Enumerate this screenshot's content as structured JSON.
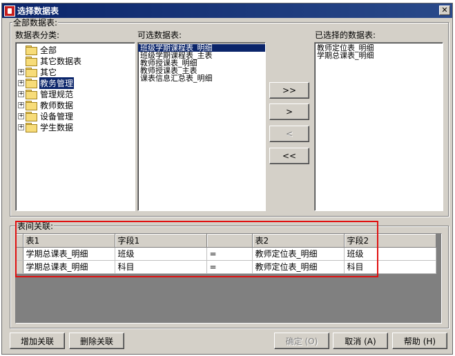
{
  "window": {
    "title": "选择数据表",
    "close_glyph": "✕"
  },
  "all_tables": {
    "group_title": "全部数据表:",
    "category_label": "数据表分类:",
    "available_label": "可选数据表:",
    "selected_label": "已选择的数据表:"
  },
  "categories": [
    {
      "label": "全部",
      "expandable": false,
      "selected": false
    },
    {
      "label": "其它数据表",
      "expandable": false,
      "selected": false
    },
    {
      "label": "其它",
      "expandable": true,
      "selected": false
    },
    {
      "label": "教务管理",
      "expandable": true,
      "selected": true
    },
    {
      "label": "管理规范",
      "expandable": true,
      "selected": false
    },
    {
      "label": "教师数据",
      "expandable": true,
      "selected": false
    },
    {
      "label": "设备管理",
      "expandable": true,
      "selected": false
    },
    {
      "label": "学生数据",
      "expandable": true,
      "selected": false
    }
  ],
  "available_tables": [
    {
      "label": "班级学期课程表_明细",
      "selected": true
    },
    {
      "label": "班级学期课程表_主表",
      "selected": false
    },
    {
      "label": "教师授课表_明细",
      "selected": false
    },
    {
      "label": "教师授课表_主表",
      "selected": false
    },
    {
      "label": "课表信息汇总表_明细",
      "selected": false
    }
  ],
  "selected_tables": [
    {
      "label": "教师定位表_明细"
    },
    {
      "label": "学期总课表_明细"
    }
  ],
  "transfer_buttons": {
    "add_all": ">>",
    "add_one": ">",
    "remove_one": "<",
    "remove_all": "<<"
  },
  "relations": {
    "group_title": "表间关联:",
    "columns": [
      "表1",
      "字段1",
      "",
      "表2",
      "字段2"
    ],
    "rows": [
      [
        "学期总课表_明细",
        "班级",
        "=",
        "教师定位表_明细",
        "班级"
      ],
      [
        "学期总课表_明细",
        "科目",
        "=",
        "教师定位表_明细",
        "科目"
      ]
    ]
  },
  "footer": {
    "add_relation": "增加关联",
    "delete_relation": "删除关联",
    "ok": "确定 (O)",
    "cancel": "取消 (A)",
    "help": "帮助 (H)"
  },
  "colors": {
    "titlebar": "#0a246a",
    "dialog_bg": "#d4d0c8",
    "selection": "#0a246a",
    "highlight_annotation": "#e01010"
  }
}
